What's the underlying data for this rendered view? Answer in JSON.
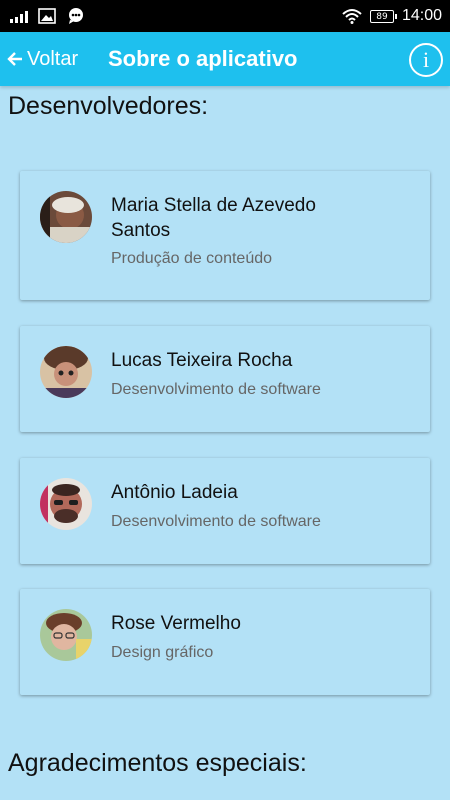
{
  "status_bar": {
    "time": "14:00",
    "battery": "89"
  },
  "app_bar": {
    "back_label": "Voltar",
    "title": "Sobre o aplicativo",
    "info_glyph": "i"
  },
  "sections": {
    "developers_heading": "Desenvolvedores:",
    "thanks_heading": "Agradecimentos especiais:"
  },
  "developers": [
    {
      "name": "Maria Stella de Azevedo Santos",
      "role": "Produção de conteúdo"
    },
    {
      "name": "Lucas Teixeira Rocha",
      "role": "Desenvolvimento de software"
    },
    {
      "name": "Antônio Ladeia",
      "role": "Desenvolvimento de software"
    },
    {
      "name": "Rose Vermelho",
      "role": "Design gráfico"
    }
  ],
  "colors": {
    "app_bar": "#1ec0ee",
    "background": "#b3e1f6"
  }
}
